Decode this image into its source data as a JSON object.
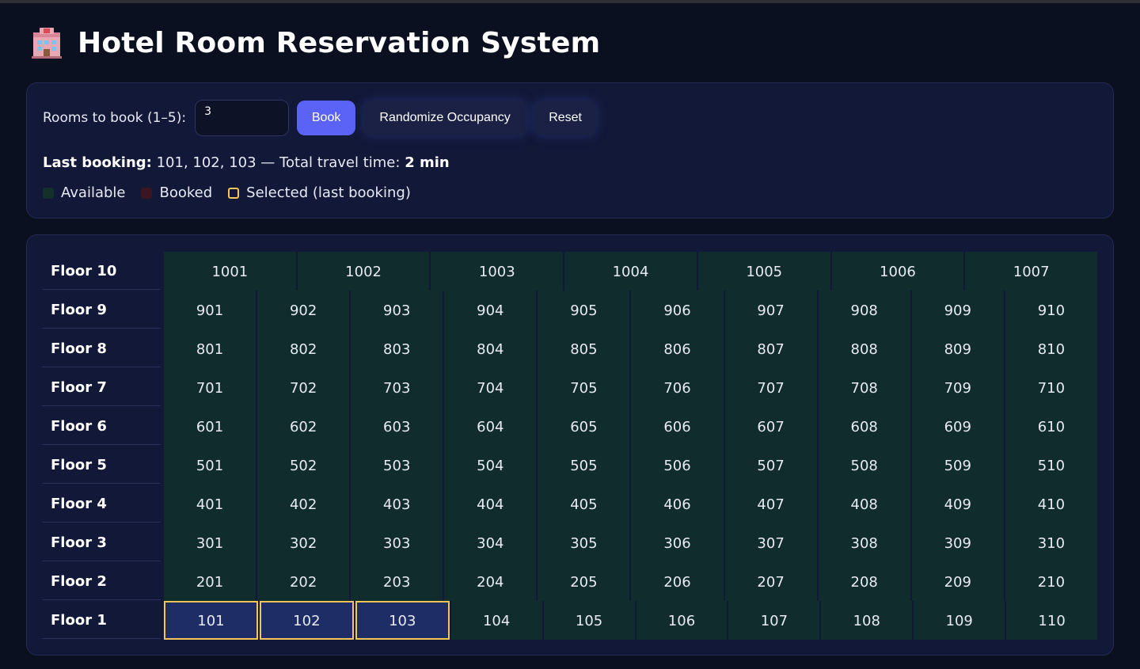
{
  "title": "Hotel Room Reservation System",
  "title_icon": "hotel-icon",
  "controls": {
    "rooms_label": "Rooms to book (1–5):",
    "rooms_value": "3",
    "book_label": "Book",
    "randomize_label": "Randomize Occupancy",
    "reset_label": "Reset"
  },
  "status": {
    "label": "Last booking:",
    "rooms": "101, 102, 103",
    "separator": "— Total travel time:",
    "travel_time": "2 min"
  },
  "legend": {
    "available": "Available",
    "booked": "Booked",
    "selected": "Selected (last booking)"
  },
  "colors": {
    "background": "#0b1020",
    "panel": "#121838",
    "available": "#102c2c",
    "booked": "#3b1520",
    "selected_border": "#f5c55a",
    "selected_fill": "#1f2d66",
    "primary_button": "#5b63f6"
  },
  "floors": [
    {
      "label": "Floor 10",
      "rooms": [
        "1001",
        "1002",
        "1003",
        "1004",
        "1005",
        "1006",
        "1007"
      ],
      "selected": []
    },
    {
      "label": "Floor 9",
      "rooms": [
        "901",
        "902",
        "903",
        "904",
        "905",
        "906",
        "907",
        "908",
        "909",
        "910"
      ],
      "selected": []
    },
    {
      "label": "Floor 8",
      "rooms": [
        "801",
        "802",
        "803",
        "804",
        "805",
        "806",
        "807",
        "808",
        "809",
        "810"
      ],
      "selected": []
    },
    {
      "label": "Floor 7",
      "rooms": [
        "701",
        "702",
        "703",
        "704",
        "705",
        "706",
        "707",
        "708",
        "709",
        "710"
      ],
      "selected": []
    },
    {
      "label": "Floor 6",
      "rooms": [
        "601",
        "602",
        "603",
        "604",
        "605",
        "606",
        "607",
        "608",
        "609",
        "610"
      ],
      "selected": []
    },
    {
      "label": "Floor 5",
      "rooms": [
        "501",
        "502",
        "503",
        "504",
        "505",
        "506",
        "507",
        "508",
        "509",
        "510"
      ],
      "selected": []
    },
    {
      "label": "Floor 4",
      "rooms": [
        "401",
        "402",
        "403",
        "404",
        "405",
        "406",
        "407",
        "408",
        "409",
        "410"
      ],
      "selected": []
    },
    {
      "label": "Floor 3",
      "rooms": [
        "301",
        "302",
        "303",
        "304",
        "305",
        "306",
        "307",
        "308",
        "309",
        "310"
      ],
      "selected": []
    },
    {
      "label": "Floor 2",
      "rooms": [
        "201",
        "202",
        "203",
        "204",
        "205",
        "206",
        "207",
        "208",
        "209",
        "210"
      ],
      "selected": []
    },
    {
      "label": "Floor 1",
      "rooms": [
        "101",
        "102",
        "103",
        "104",
        "105",
        "106",
        "107",
        "108",
        "109",
        "110"
      ],
      "selected": [
        "101",
        "102",
        "103"
      ]
    }
  ]
}
